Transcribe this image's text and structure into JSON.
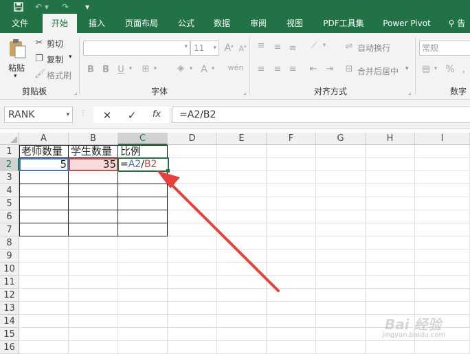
{
  "quick_access": {
    "save_icon": "save-icon",
    "undo_icon": "undo-icon",
    "redo_icon": "redo-icon",
    "customize_icon": "customize-icon"
  },
  "tabs": [
    {
      "label": "文件"
    },
    {
      "label": "开始",
      "active": true
    },
    {
      "label": "插入"
    },
    {
      "label": "页面布局"
    },
    {
      "label": "公式"
    },
    {
      "label": "数据"
    },
    {
      "label": "审阅"
    },
    {
      "label": "视图"
    },
    {
      "label": "PDF工具集"
    },
    {
      "label": "Power Pivot"
    },
    {
      "label": "告"
    }
  ],
  "ribbon": {
    "clipboard": {
      "paste_label": "粘贴",
      "cut_label": "剪切",
      "copy_label": "复制",
      "format_painter_label": "格式刷",
      "group_label": "剪贴板"
    },
    "font": {
      "font_name": "",
      "font_size": "11",
      "bold": "B",
      "italic": "I",
      "underline": "U",
      "grow": "A",
      "shrink": "A",
      "font_color": "A",
      "group_label": "字体"
    },
    "alignment": {
      "wrap_text_label": "自动换行",
      "merge_center_label": "合并后居中",
      "group_label": "对齐方式"
    },
    "number": {
      "format": "常规",
      "percent": "%",
      "group_label": "数字"
    }
  },
  "formula_bar": {
    "name_box": "RANK",
    "cancel_icon": "✕",
    "enter_icon": "✓",
    "fx_label": "fx",
    "formula": "=A2/B2"
  },
  "sheet": {
    "columns": [
      "A",
      "B",
      "C",
      "D",
      "E",
      "F",
      "G",
      "H",
      "I"
    ],
    "rows": [
      "1",
      "2",
      "3",
      "4",
      "5",
      "6",
      "7",
      "8",
      "9",
      "10",
      "11",
      "12",
      "13",
      "14",
      "15",
      "16"
    ],
    "cells": {
      "A1": "老师数量",
      "B1": "学生数量",
      "C1": "比例",
      "A2": "5",
      "B2": "35",
      "C2_eq": "=",
      "C2_ref1": "A2",
      "C2_slash": "/",
      "C2_ref2": "B2"
    },
    "active_cell": "C2",
    "colors": {
      "ref_a2": "#4472c4",
      "ref_b2": "#c0504d",
      "accent": "#217346",
      "arrow": "#e8403a"
    }
  },
  "watermark": {
    "line1": "Bai 经验",
    "line2": "jingyan.baidu.com"
  }
}
